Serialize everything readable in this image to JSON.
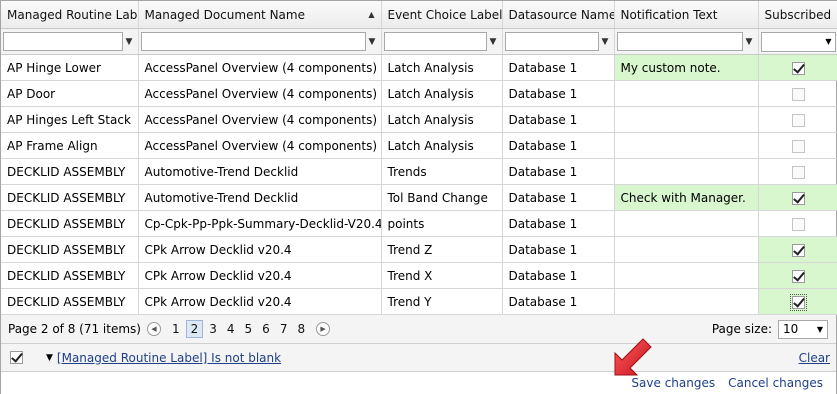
{
  "columns": [
    {
      "label": "Managed Routine Label"
    },
    {
      "label": "Managed Document Name"
    },
    {
      "label": "Event Choice Label"
    },
    {
      "label": "Datasource Name"
    },
    {
      "label": "Notification Text"
    },
    {
      "label": "Subscribed"
    }
  ],
  "rows": [
    {
      "routine": "AP Hinge Lower",
      "document": "AccessPanel Overview (4 components)",
      "event": "Latch Analysis",
      "datasource": "Database 1",
      "note": "My custom note.",
      "subscribed": true
    },
    {
      "routine": "AP Door",
      "document": "AccessPanel Overview (4 components)",
      "event": "Latch Analysis",
      "datasource": "Database 1",
      "note": "",
      "subscribed": false
    },
    {
      "routine": "AP Hinges Left Stack",
      "document": "AccessPanel Overview (4 components)",
      "event": "Latch Analysis",
      "datasource": "Database 1",
      "note": "",
      "subscribed": false
    },
    {
      "routine": "AP Frame Align",
      "document": "AccessPanel Overview (4 components)",
      "event": "Latch Analysis",
      "datasource": "Database 1",
      "note": "",
      "subscribed": false
    },
    {
      "routine": "DECKLID ASSEMBLY",
      "document": "Automotive-Trend Decklid",
      "event": "Trends",
      "datasource": "Database 1",
      "note": "",
      "subscribed": false
    },
    {
      "routine": "DECKLID ASSEMBLY",
      "document": "Automotive-Trend Decklid",
      "event": "Tol Band Change",
      "datasource": "Database 1",
      "note": "Check with Manager.",
      "subscribed": true
    },
    {
      "routine": "DECKLID ASSEMBLY",
      "document": "Cp-Cpk-Pp-Ppk-Summary-Decklid-V20.4",
      "event": "points",
      "datasource": "Database 1",
      "note": "",
      "subscribed": false
    },
    {
      "routine": "DECKLID ASSEMBLY",
      "document": "CPk Arrow Decklid v20.4",
      "event": "Trend Z",
      "datasource": "Database 1",
      "note": "",
      "subscribed": true
    },
    {
      "routine": "DECKLID ASSEMBLY",
      "document": "CPk Arrow Decklid v20.4",
      "event": "Trend X",
      "datasource": "Database 1",
      "note": "",
      "subscribed": true
    },
    {
      "routine": "DECKLID ASSEMBLY",
      "document": "CPk Arrow Decklid v20.4",
      "event": "Trend Y",
      "datasource": "Database 1",
      "note": "",
      "subscribed": true
    }
  ],
  "pager": {
    "info": "Page 2 of 8 (71 items)",
    "pages": [
      "1",
      "2",
      "3",
      "4",
      "5",
      "6",
      "7",
      "8"
    ],
    "current": "2",
    "page_size_label": "Page size:",
    "page_size": "10"
  },
  "filter_bar": {
    "expression": "[Managed Routine Label] Is not blank",
    "clear_label": "Clear"
  },
  "actions": {
    "save_label": "Save changes",
    "cancel_label": "Cancel changes"
  },
  "colors": {
    "modified_cell": "#d9f7cf",
    "link": "#1e3f8a",
    "arrow": "#e8232a"
  },
  "icons": {
    "filter": "funnel-icon",
    "prev": "chevron-left-icon",
    "next": "chevron-right-icon",
    "dropdown": "chevron-down-icon",
    "callout": "red-arrow-icon"
  }
}
